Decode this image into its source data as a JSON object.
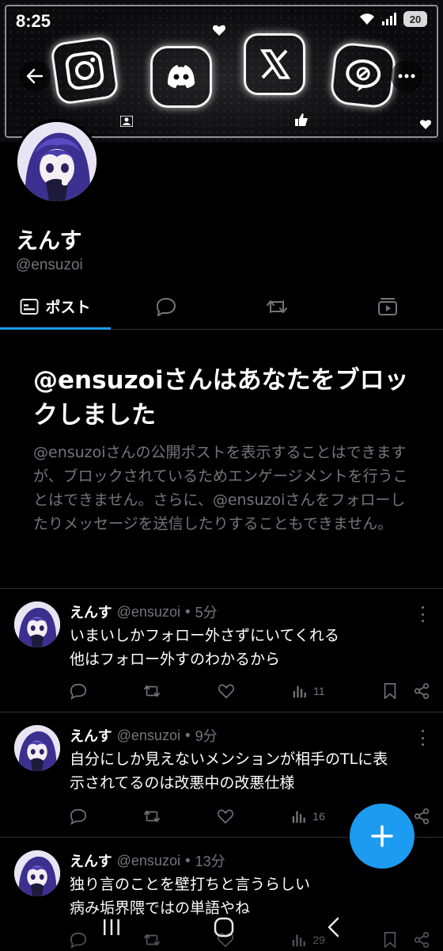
{
  "status_bar": {
    "time": "8:25",
    "battery": "20"
  },
  "profile": {
    "display_name": "えんす",
    "handle": "@ensuzoi"
  },
  "tabs": [
    {
      "label": "ポスト",
      "icon": "posts-icon",
      "active": true
    },
    {
      "icon": "replies-icon"
    },
    {
      "icon": "reposts-icon"
    },
    {
      "icon": "media-icon"
    }
  ],
  "block_notice": {
    "title": "@ensuzoiさんはあなたをブロックしました",
    "description": "@ensuzoiさんの公開ポストを表示することはできますが、ブロックされているためエンゲージメントを行うことはできません。さらに、@ensuzoiさんをフォローしたりメッセージを送信したりすることもできません。"
  },
  "posts": [
    {
      "name": "えんす",
      "handle": "@ensuzoi",
      "time": "5分",
      "lines": [
        "いまいしかフォロー外さずにいてくれる",
        "他はフォロー外すのわかるから"
      ],
      "views": "11"
    },
    {
      "name": "えんす",
      "handle": "@ensuzoi",
      "time": "9分",
      "lines": [
        "自分にしか見えないメンションが相手のTLに表",
        "示されてるのは改悪中の改悪仕様"
      ],
      "views": "16"
    },
    {
      "name": "えんす",
      "handle": "@ensuzoi",
      "time": "13分",
      "lines": [
        "独り言のことを壁打ちと言うらしい",
        "病み垢界隈ではの単語やね"
      ],
      "views": "29"
    }
  ],
  "colors": {
    "accent": "#1d9bf0",
    "muted": "#71767b",
    "divider": "#2f3336",
    "background": "#000000"
  }
}
